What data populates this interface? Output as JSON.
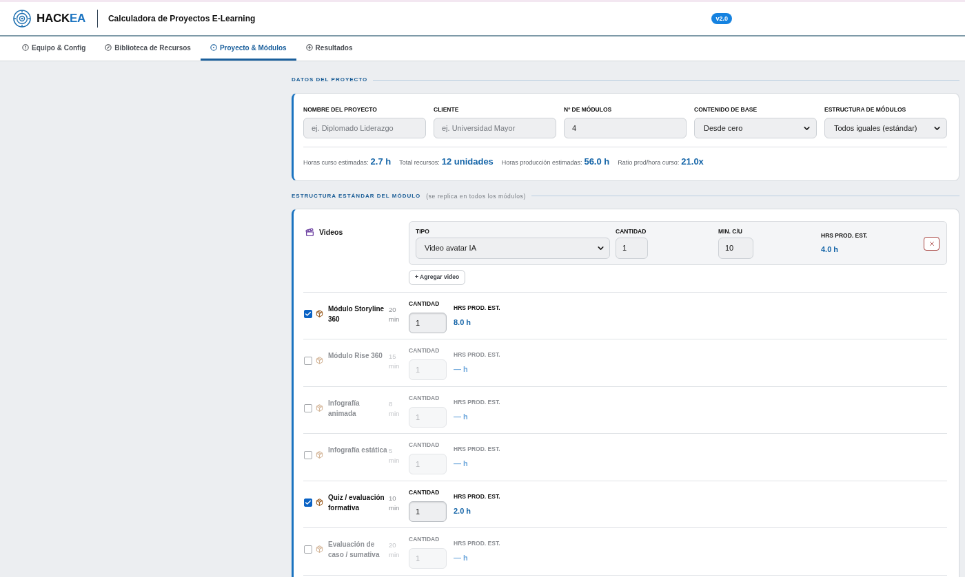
{
  "header": {
    "logo": {
      "text": "HACK",
      "accent": "EA"
    },
    "title": "Calculadora de Proyectos E-Learning",
    "version": "v2.0"
  },
  "tabs": [
    {
      "label": "Equipo & Config",
      "selected": false
    },
    {
      "label": "Biblioteca de Recursos",
      "selected": false
    },
    {
      "label": "Proyecto & Módulos",
      "selected": true
    },
    {
      "label": "Resultados",
      "selected": false
    }
  ],
  "project": {
    "heading": "DATOS DEL PROYECTO",
    "fields": [
      {
        "kind": "text",
        "label": "NOMBRE DEL PROYECTO",
        "placeholder": "ej. Diplomado Liderazgo"
      },
      {
        "kind": "text",
        "label": "CLIENTE",
        "placeholder": "ej. Universidad Mayor"
      },
      {
        "kind": "text",
        "label": "Nº DE MÓDULOS",
        "value": "4"
      },
      {
        "kind": "select",
        "label": "CONTENIDO DE BASE",
        "value": "Desde cero"
      },
      {
        "kind": "select",
        "label": "ESTRUCTURA DE MÓDULOS",
        "value": "Todos iguales (estándar)"
      }
    ],
    "stats": [
      {
        "label": "Horas curso estimadas:",
        "value": "2.7 h"
      },
      {
        "label": "Total recursos:",
        "value": "12 unidades"
      },
      {
        "label": "Horas producción estimadas:",
        "value": "56.0 h"
      },
      {
        "label": "Ratio prod/hora curso:",
        "value": "21.0x"
      }
    ]
  },
  "structure": {
    "heading": "ESTRUCTURA ESTÁNDAR DEL MÓDULO",
    "note": "(se replica en todos los módulos)",
    "videos": {
      "label": "Videos",
      "entries": [
        {
          "type_label": "TIPO",
          "type": "Video avatar IA",
          "quantity_label": "CANTIDAD",
          "quantity": "1",
          "minutes_label": "MIN. C/U",
          "minutes": "10",
          "hours_label": "HRS PROD. EST.",
          "hours": "4.0 h"
        }
      ],
      "add_button": "+ Agregar video"
    },
    "resources": [
      {
        "checked": true,
        "name": "Módulo Storyline 360",
        "minutes": "20 min",
        "quantity_label": "CANTIDAD",
        "quantity": "1",
        "hours_label": "HRS PROD. EST.",
        "hours": "8.0 h"
      },
      {
        "checked": false,
        "name": "Módulo Rise 360",
        "minutes": "15 min",
        "quantity_label": "CANTIDAD",
        "quantity": "1",
        "hours_label": "HRS PROD. EST.",
        "hours": "— h"
      },
      {
        "checked": false,
        "name": "Infografía animada",
        "minutes": "8 min",
        "quantity_label": "CANTIDAD",
        "quantity": "1",
        "hours_label": "HRS PROD. EST.",
        "hours": "— h"
      },
      {
        "checked": false,
        "name": "Infografía estática",
        "minutes": "5 min",
        "quantity_label": "CANTIDAD",
        "quantity": "1",
        "hours_label": "HRS PROD. EST.",
        "hours": "— h"
      },
      {
        "checked": true,
        "name": "Quiz / evaluación formativa",
        "minutes": "10 min",
        "quantity_label": "CANTIDAD",
        "quantity": "1",
        "hours_label": "HRS PROD. EST.",
        "hours": "2.0 h"
      },
      {
        "checked": false,
        "name": "Evaluación de caso / sumativa",
        "minutes": "20 min",
        "quantity_label": "CANTIDAD",
        "quantity": "1",
        "hours_label": "HRS PROD. EST.",
        "hours": "— h"
      }
    ]
  }
}
